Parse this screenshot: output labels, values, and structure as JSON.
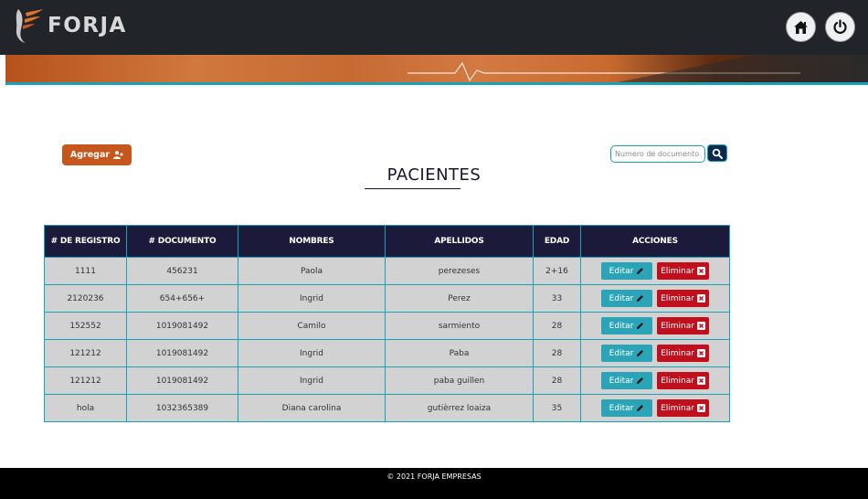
{
  "header": {
    "logo_text": "FORJA",
    "home_icon": "home-icon",
    "power_icon": "power-icon"
  },
  "toolbar": {
    "add_label": "Agregar",
    "add_icon": "user-plus-icon",
    "search_placeholder": "Numero de documento",
    "search_icon": "search-icon"
  },
  "page": {
    "title": "PACIENTES"
  },
  "table": {
    "columns": [
      "# DE REGISTRO",
      "# DOCUMENTO",
      "NOMBRES",
      "APELLIDOS",
      "EDAD",
      "ACCIONES"
    ],
    "rows": [
      {
        "registro": "1111",
        "documento": "456231",
        "nombres": "Paola",
        "apellidos": "perezeses",
        "edad": "2+16"
      },
      {
        "registro": "2120236",
        "documento": "654+656+",
        "nombres": "Ingrid",
        "apellidos": "Perez",
        "edad": "33"
      },
      {
        "registro": "152552",
        "documento": "1019081492",
        "nombres": "Camilo",
        "apellidos": "sarmiento",
        "edad": "28"
      },
      {
        "registro": "121212",
        "documento": "1019081492",
        "nombres": "Ingrid",
        "apellidos": "Paba",
        "edad": "28"
      },
      {
        "registro": "121212",
        "documento": "1019081492",
        "nombres": "Ingrid",
        "apellidos": "paba guillen",
        "edad": "28"
      },
      {
        "registro": "hola",
        "documento": "1032365389",
        "nombres": "Diana carolina",
        "apellidos": "gutièrrez loaiza",
        "edad": "35"
      }
    ],
    "edit_label": "Editar",
    "delete_label": "Eliminar"
  },
  "footer": {
    "text": "© 2021 FORJA EMPRESAS"
  },
  "colors": {
    "topbar": "#212529",
    "accent_orange": "#c6571c",
    "teal": "#17a2b8",
    "table_header": "#1c1a3a",
    "delete_red": "#c0101d"
  }
}
